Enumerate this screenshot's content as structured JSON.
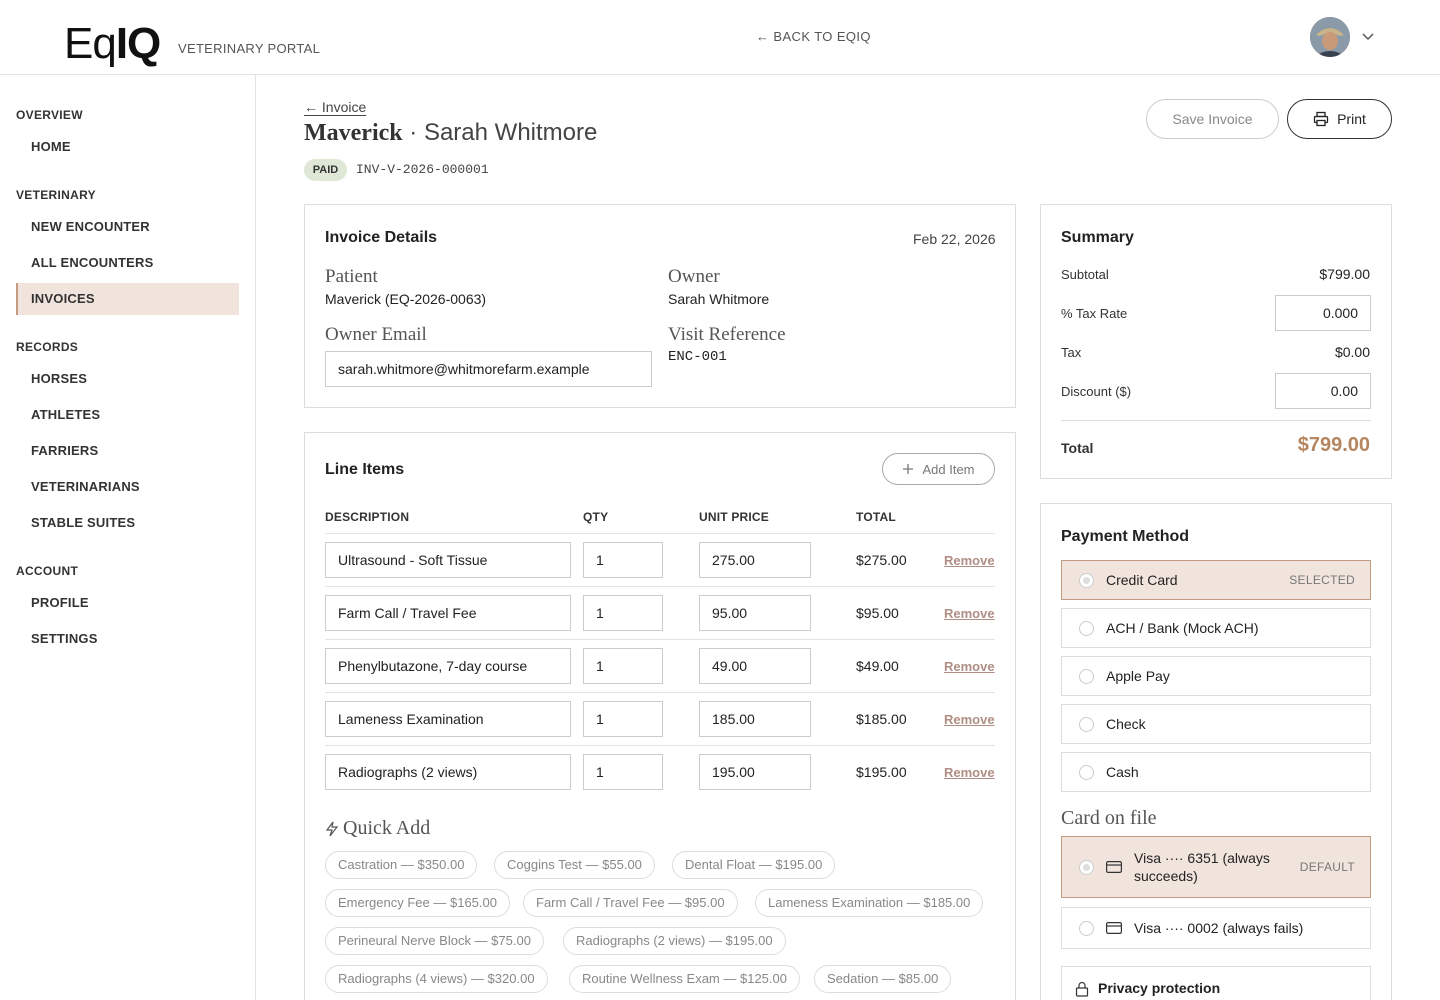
{
  "header": {
    "logo_light": "Eq",
    "logo_bold": "IQ",
    "portal_label": "VETERINARY PORTAL",
    "back_link": "← BACK TO EQIQ"
  },
  "sidebar": {
    "sections": [
      {
        "title": "OVERVIEW",
        "items": [
          "HOME"
        ]
      },
      {
        "title": "VETERINARY",
        "items": [
          "NEW ENCOUNTER",
          "ALL ENCOUNTERS",
          "INVOICES"
        ]
      },
      {
        "title": "RECORDS",
        "items": [
          "HORSES",
          "ATHLETES",
          "FARRIERS",
          "VETERINARIANS",
          "STABLE SUITES"
        ]
      },
      {
        "title": "ACCOUNT",
        "items": [
          "PROFILE",
          "SETTINGS"
        ]
      }
    ],
    "active": "INVOICES"
  },
  "page": {
    "back_link": "← Invoice",
    "patient_name": "Maverick",
    "separator": " · ",
    "owner_name": "Sarah Whitmore",
    "status_badge": "PAID",
    "invoice_number": "INV-V-2026-000001",
    "save_button": "Save Invoice",
    "print_button": "Print"
  },
  "invoice_details": {
    "title": "Invoice Details",
    "date": "Feb 22, 2026",
    "patient_label": "Patient",
    "patient_value": "Maverick (EQ-2026-0063)",
    "owner_label": "Owner",
    "owner_value": "Sarah Whitmore",
    "email_label": "Owner Email",
    "email_value": "sarah.whitmore@whitmorefarm.example",
    "visit_label": "Visit Reference",
    "visit_value": "ENC-001"
  },
  "line_items": {
    "title": "Line Items",
    "add_button": "Add Item",
    "columns": [
      "DESCRIPTION",
      "QTY",
      "UNIT PRICE",
      "TOTAL"
    ],
    "remove_label": "Remove",
    "rows": [
      {
        "description": "Ultrasound - Soft Tissue",
        "qty": "1",
        "unit_price": "275.00",
        "total": "$275.00"
      },
      {
        "description": "Farm Call / Travel Fee",
        "qty": "1",
        "unit_price": "95.00",
        "total": "$95.00"
      },
      {
        "description": "Phenylbutazone, 7-day course",
        "qty": "1",
        "unit_price": "49.00",
        "total": "$49.00"
      },
      {
        "description": "Lameness Examination",
        "qty": "1",
        "unit_price": "185.00",
        "total": "$185.00"
      },
      {
        "description": "Radiographs (2 views)",
        "qty": "1",
        "unit_price": "195.00",
        "total": "$195.00"
      }
    ]
  },
  "quick_add": {
    "title": "Quick Add",
    "chips": [
      "Castration — $350.00",
      "Coggins Test — $55.00",
      "Dental Float — $195.00",
      "Emergency Fee — $165.00",
      "Farm Call / Travel Fee — $95.00",
      "Lameness Examination — $185.00",
      "Perineural Nerve Block — $75.00",
      "Radiographs (2 views) — $195.00",
      "Radiographs (4 views) — $320.00",
      "Routine Wellness Exam — $125.00",
      "Sedation — $85.00"
    ]
  },
  "summary": {
    "title": "Summary",
    "subtotal_label": "Subtotal",
    "subtotal_value": "$799.00",
    "tax_rate_label": "% Tax Rate",
    "tax_rate_value": "0.000",
    "tax_label": "Tax",
    "tax_value": "$0.00",
    "discount_label": "Discount ($)",
    "discount_value": "0.00",
    "total_label": "Total",
    "total_value": "$799.00",
    "total_color": "#b5865f"
  },
  "payment": {
    "title": "Payment Method",
    "selected_tag": "SELECTED",
    "methods": [
      "Credit Card",
      "ACH / Bank (Mock ACH)",
      "Apple Pay",
      "Check",
      "Cash"
    ],
    "card_on_file_title": "Card on file",
    "cards": [
      {
        "label": "Visa ···· 6351 (always succeeds)",
        "tag": "DEFAULT"
      },
      {
        "label": "Visa ···· 0002 (always fails)",
        "tag": ""
      }
    ],
    "privacy_title": "Privacy protection"
  },
  "colors": {
    "accent_bg": "#f1e4dd",
    "accent_border": "#c49a80",
    "paid_badge": "#dfe8d6",
    "remove_link": "#b08e84"
  }
}
